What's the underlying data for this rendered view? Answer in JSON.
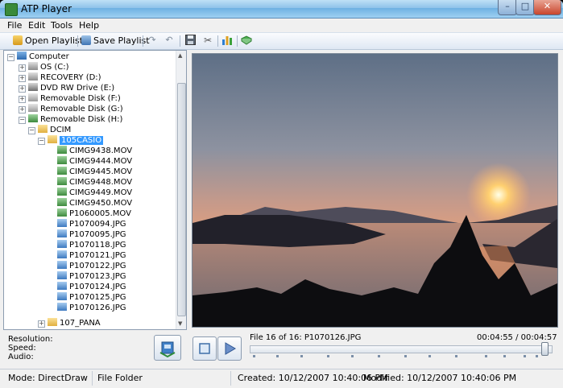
{
  "window": {
    "title": "ATP Player"
  },
  "window_controls": {
    "minimize": "–",
    "maximize": "□",
    "close": "✕"
  },
  "menu": [
    "File",
    "Edit",
    "Tools",
    "Help"
  ],
  "toolbar": {
    "open_playlist": "Open Playlist",
    "save_playlist": "Save Playlist"
  },
  "tree": {
    "root": "Computer",
    "drives": [
      "OS (C:)",
      "RECOVERY (D:)",
      "DVD RW Drive (E:)",
      "Removable Disk (F:)",
      "Removable Disk (G:)",
      "Removable Disk (H:)"
    ],
    "folders": [
      "DCIM",
      "105CASIO",
      "107_PANA"
    ],
    "files": [
      "CIMG9438.MOV",
      "CIMG9444.MOV",
      "CIMG9445.MOV",
      "CIMG9448.MOV",
      "CIMG9449.MOV",
      "CIMG9450.MOV",
      "P1060005.MOV",
      "P1070094.JPG",
      "P1070095.JPG",
      "P1070118.JPG",
      "P1070121.JPG",
      "P1070122.JPG",
      "P1070123.JPG",
      "P1070124.JPG",
      "P1070125.JPG",
      "P1070126.JPG"
    ]
  },
  "info": {
    "resolution_label": "Resolution:",
    "speed_label": "Speed:",
    "audio_label": "Audio:"
  },
  "player": {
    "file_info": "File 16 of 16: P1070126.JPG",
    "time": "00:04:55 / 00:04:57",
    "seek_fraction": 0.99
  },
  "status": {
    "mode": "Mode: DirectDraw",
    "type": "File Folder",
    "created": "Created: 10/12/2007 10:40:06 PM",
    "modified": "Modified: 10/12/2007 10:40:06 PM"
  }
}
